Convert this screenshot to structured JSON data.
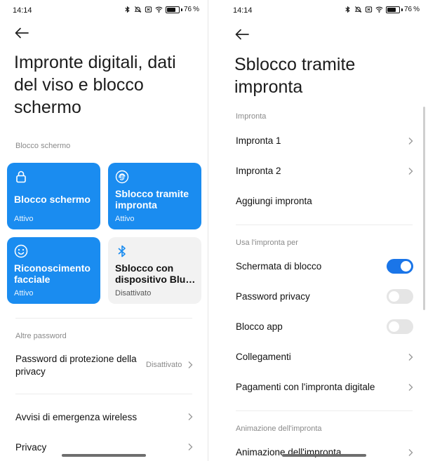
{
  "left": {
    "status": {
      "time": "14:14",
      "battery": "76",
      "battery_level": 0.76
    },
    "title": "Impronte digitali, dati del viso e blocco schermo",
    "section_lock": "Blocco schermo",
    "tiles": [
      {
        "title": "Blocco schermo",
        "status": "Attivo",
        "icon": "lock-icon",
        "active": true
      },
      {
        "title": "Sblocco tramite impronta",
        "status": "Attivo",
        "icon": "fingerprint-icon",
        "active": true
      },
      {
        "title": "Riconoscimento facciale",
        "status": "Attivo",
        "icon": "face-icon",
        "active": true
      },
      {
        "title": "Sblocco con dispositivo Blu…",
        "status": "Disattivato",
        "icon": "bluetooth-icon",
        "active": false
      }
    ],
    "section_other": "Altre password",
    "rows": [
      {
        "label": "Password di protezione della privacy",
        "value": "Disattivato"
      },
      {
        "label": "Avvisi di emergenza wireless",
        "value": ""
      },
      {
        "label": "Privacy",
        "value": ""
      }
    ]
  },
  "right": {
    "status": {
      "time": "14:14",
      "battery": "76",
      "battery_level": 0.76
    },
    "title": "Sblocco tramite impronta",
    "section_fingerprint": "Impronta",
    "fingerprint_rows": [
      {
        "label": "Impronta 1"
      },
      {
        "label": "Impronta 2"
      },
      {
        "label": "Aggiungi impronta"
      }
    ],
    "section_use": "Usa l'impronta per",
    "use_rows": [
      {
        "label": "Schermata di blocco",
        "toggle": true
      },
      {
        "label": "Password privacy",
        "toggle": false
      },
      {
        "label": "Blocco app",
        "toggle": false
      },
      {
        "label": "Collegamenti"
      },
      {
        "label": "Pagamenti con l'impronta digitale"
      }
    ],
    "section_animation": "Animazione dell'impronta",
    "animation_rows": [
      {
        "label": "Animazione dell'impronta"
      }
    ]
  },
  "colors": {
    "accent": "#1a8cf0",
    "toggle_on": "#1a75e8",
    "tile_inactive": "#f2f2f2"
  }
}
